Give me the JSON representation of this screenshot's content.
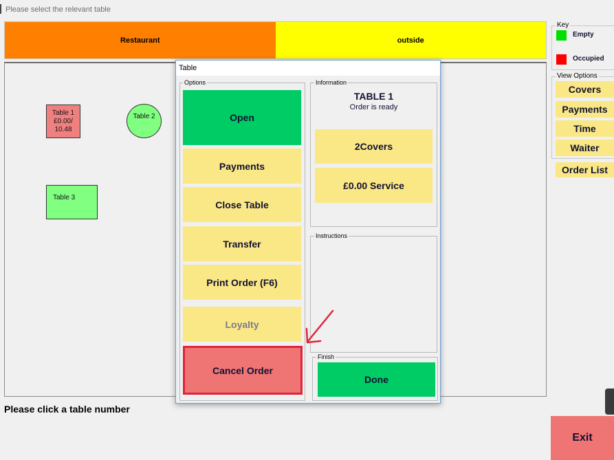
{
  "window": {
    "title": "Please select the relevant table"
  },
  "areas": [
    {
      "label": "Restaurant",
      "color": "#ff8000"
    },
    {
      "label": "outside",
      "color": "#ffff00"
    }
  ],
  "tables": [
    {
      "label": "Table 1\n£0.00/\n10.48",
      "status": "occupied",
      "color": "#f08080"
    },
    {
      "label": "Table 2",
      "status": "empty",
      "color": "#80ff80"
    },
    {
      "label": "Table 3",
      "status": "empty",
      "color": "#80ff80"
    }
  ],
  "status_text": "Please click a table number",
  "key": {
    "title": "Key",
    "empty_label": "Empty",
    "empty_color": "#00e000",
    "occupied_label": "Occupied",
    "occupied_color": "#ff0000"
  },
  "view_options": {
    "title": "View Options",
    "buttons": [
      "Covers",
      "Payments",
      "Time",
      "Waiter"
    ]
  },
  "order_list_label": "Order List",
  "exit_label": "Exit",
  "dialog": {
    "title": "Table",
    "options_group": "Options",
    "options": {
      "open": "Open",
      "payments": "Payments",
      "close_table": "Close Table",
      "transfer": "Transfer",
      "print_order": "Print Order (F6)",
      "loyalty": "Loyalty",
      "cancel_order": "Cancel Order"
    },
    "information_group": "Information",
    "table_name": "TABLE 1",
    "order_status": "Order is ready",
    "covers": "2Covers",
    "service": "£0.00 Service",
    "instructions_group": "Instructions",
    "finish_group": "Finish",
    "done": "Done"
  },
  "annotation_color": "#e0233a"
}
